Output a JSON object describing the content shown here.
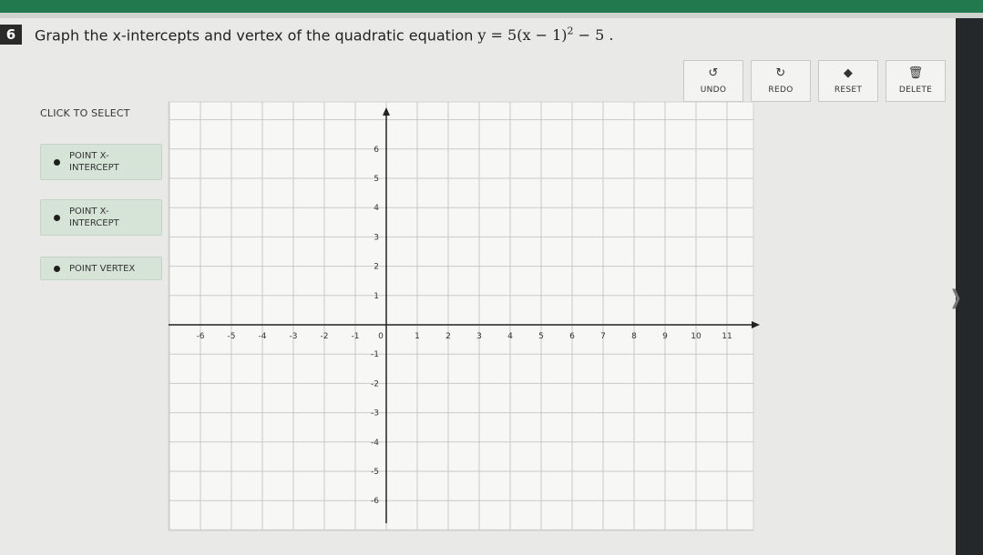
{
  "question": {
    "number": "6",
    "text": "Graph the x-intercepts and vertex of the quadratic equation",
    "equation": "y = 5(x − 1)",
    "exponent": "2",
    "equation_tail": " − 5 ."
  },
  "toolbar": [
    {
      "label": "UNDO",
      "icon": "undo-icon"
    },
    {
      "label": "REDO",
      "icon": "redo-icon"
    },
    {
      "label": "RESET",
      "icon": "eraser-icon"
    },
    {
      "label": "DELETE",
      "icon": "trash-icon"
    }
  ],
  "select_panel": {
    "title": "CLICK TO SELECT",
    "options": [
      {
        "line1": "POINT X-",
        "line2": "INTERCEPT"
      },
      {
        "line1": "POINT X-",
        "line2": "INTERCEPT"
      },
      {
        "line1": "POINT VERTEX",
        "line2": ""
      }
    ]
  },
  "graph": {
    "x_ticks": [
      "-6",
      "-5",
      "-4",
      "-3",
      "-2",
      "-1",
      "0",
      "1",
      "2",
      "3",
      "4",
      "5",
      "6",
      "7",
      "8",
      "9",
      "10",
      "11"
    ],
    "y_ticks": [
      "6",
      "5",
      "4",
      "3",
      "2",
      "1",
      "-1",
      "-2",
      "-3",
      "-4",
      "-5",
      "-6"
    ],
    "x_range": [
      -7,
      12
    ],
    "y_range": [
      -7,
      7
    ]
  },
  "colors": {
    "topbar": "#23794e",
    "option_bg": "#d6e4d8"
  }
}
